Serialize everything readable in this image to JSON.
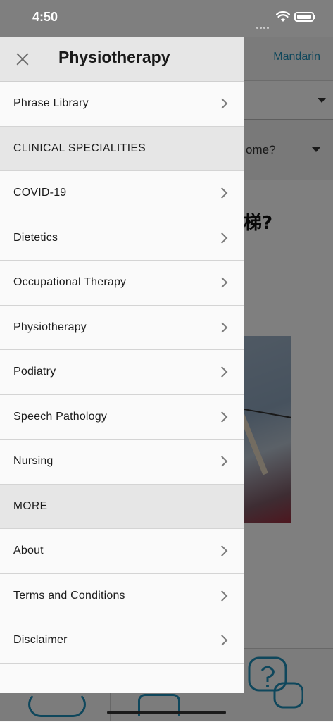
{
  "status_bar": {
    "time": "4:50"
  },
  "background": {
    "language": "Mandarin",
    "question_partial": "ome?",
    "phrase_partial": "梯?",
    "accent_color": "#1f8fb8"
  },
  "drawer": {
    "title": "Physiotherapy",
    "close_icon": "close-icon",
    "items": [
      {
        "label": "Phrase Library",
        "type": "link"
      },
      {
        "label": "CLINICAL SPECIALITIES",
        "type": "section"
      },
      {
        "label": "COVID-19",
        "type": "link"
      },
      {
        "label": "Dietetics",
        "type": "link"
      },
      {
        "label": "Occupational Therapy",
        "type": "link"
      },
      {
        "label": "Physiotherapy",
        "type": "link"
      },
      {
        "label": "Podiatry",
        "type": "link"
      },
      {
        "label": "Speech Pathology",
        "type": "link"
      },
      {
        "label": "Nursing",
        "type": "link"
      },
      {
        "label": "MORE",
        "type": "section"
      },
      {
        "label": "About",
        "type": "link"
      },
      {
        "label": "Terms and Conditions",
        "type": "link"
      },
      {
        "label": "Disclaimer",
        "type": "link"
      }
    ]
  }
}
